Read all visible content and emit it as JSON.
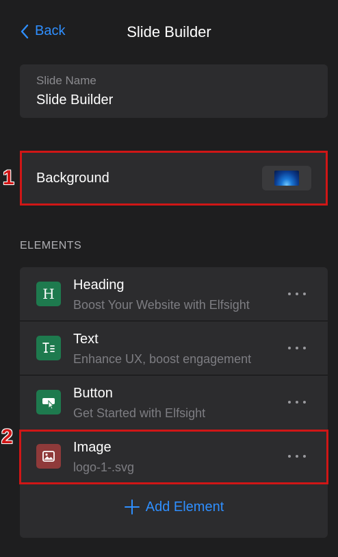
{
  "header": {
    "back_label": "Back",
    "title": "Slide Builder"
  },
  "slide_name": {
    "label": "Slide Name",
    "value": "Slide Builder"
  },
  "background": {
    "label": "Background"
  },
  "annotations": {
    "marker_1": "1",
    "marker_2": "2"
  },
  "elements": {
    "section_label": "ELEMENTS",
    "items": [
      {
        "title": "Heading",
        "subtitle": "Boost Your Website with Elfsight",
        "icon": "heading-icon"
      },
      {
        "title": "Text",
        "subtitle": "Enhance UX, boost engagement",
        "icon": "text-icon"
      },
      {
        "title": "Button",
        "subtitle": "Get Started with Elfsight",
        "icon": "button-icon"
      },
      {
        "title": "Image",
        "subtitle": "logo-1-.svg",
        "icon": "image-icon"
      }
    ],
    "add_label": "Add Element"
  },
  "colors": {
    "accent": "#2f8fff",
    "highlight": "#d01616",
    "icon_green": "#1e7a4e",
    "icon_red": "#8f3a3a"
  }
}
